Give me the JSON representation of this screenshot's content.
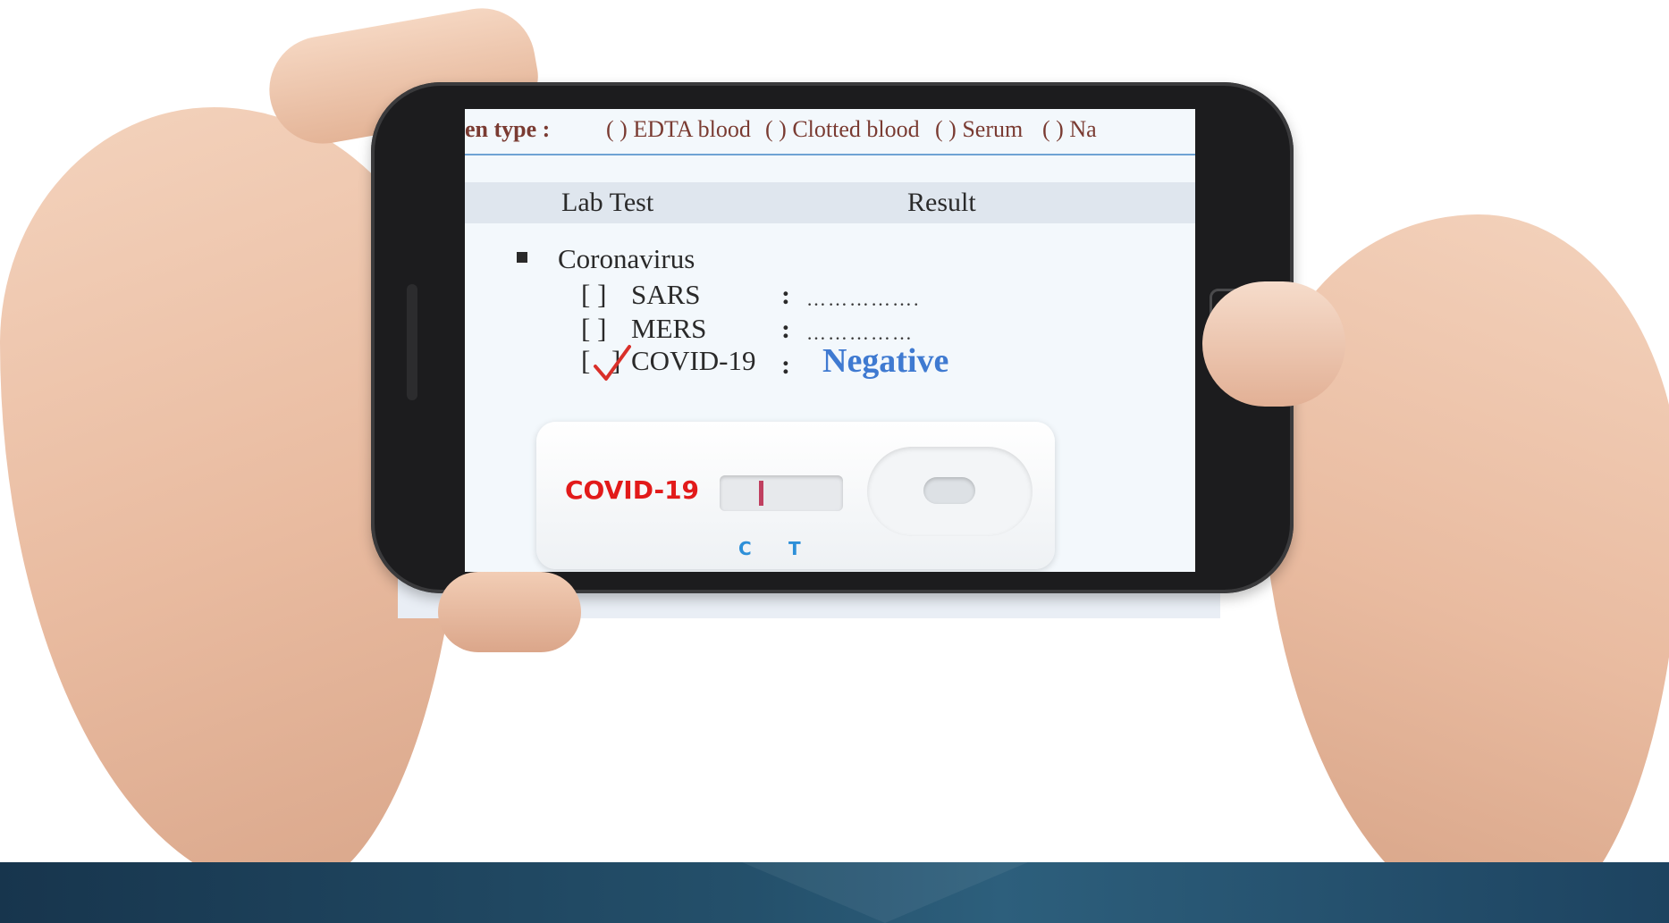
{
  "document": {
    "specimen_label": "en type :",
    "specimen_options": [
      "( ) EDTA blood",
      "( ) Clotted blood",
      "( ) Serum",
      "( )  Na"
    ],
    "column_headers": {
      "test": "Lab Test",
      "result": "Result"
    },
    "category": "Coronavirus",
    "tests": [
      {
        "box": "[ ]",
        "name": "SARS",
        "colon": ":",
        "result": "……………."
      },
      {
        "box": "[ ]",
        "name": "MERS",
        "colon": ":",
        "result": "……………"
      },
      {
        "box": "[",
        "box_end": "]",
        "name": "COVID-19",
        "colon": ":",
        "result": "Negative",
        "checked": true
      }
    ]
  },
  "cassette": {
    "label": "COVID-19",
    "marks": [
      "C",
      "T"
    ]
  },
  "colors": {
    "negative_text": "#3f7ad1",
    "cassette_label": "#e21a1a",
    "check_mark": "#d9302a",
    "band": "#24506b"
  }
}
